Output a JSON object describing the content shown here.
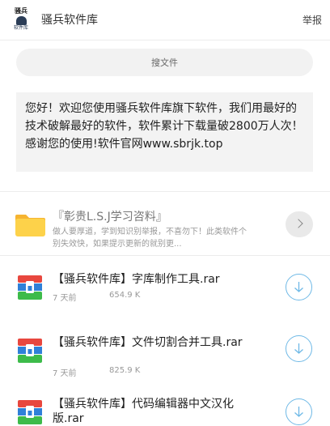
{
  "header": {
    "avatar_top": "骚兵",
    "avatar_bottom": "软件库",
    "title": "骚兵软件库",
    "report_label": "举报"
  },
  "search": {
    "placeholder": "搜文件"
  },
  "notice": {
    "text": "您好！欢迎您使用骚兵软件库旗下软件，我们用最好的技术破解最好的软件，软件累计下载量破2800万人次！感谢您的使用!软件官网www.sbrjk.top"
  },
  "folder": {
    "name": "『彰贵L.S.J学习咨料』",
    "description": "做人要厚道，学到知识别举报，不喜勿下！此类软件个别失效快，如果提示更新的就别更...",
    "icon": "folder-icon",
    "colors": {
      "folder": "#fdd24a",
      "folder_tab": "#f6b431"
    }
  },
  "files": [
    {
      "name": "【骚兵软件库】字库制作工具.rar",
      "time": "7 天前",
      "size": "654.9 K",
      "icon": "rar-archive-icon"
    },
    {
      "name": "【骚兵软件库】文件切割合并工具.rar",
      "time": "7 天前",
      "size": "825.9 K",
      "icon": "rar-archive-icon"
    },
    {
      "name": "【骚兵软件库】代码编辑器中文汉化版.rar",
      "time": "",
      "size": "",
      "icon": "rar-archive-icon"
    }
  ],
  "colors": {
    "accent": "#6fb9e6",
    "rar_red": "#e8473e",
    "rar_blue": "#2f80d8",
    "rar_green": "#3dbb4a"
  }
}
